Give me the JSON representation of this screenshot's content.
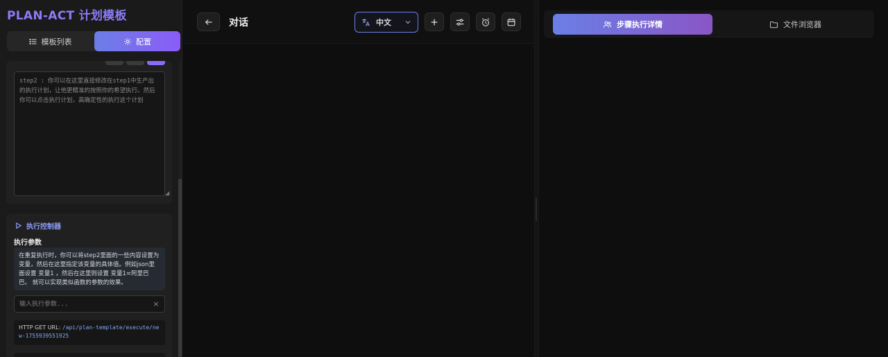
{
  "app": {
    "title": "PLAN-ACT 计划模板"
  },
  "sidebar": {
    "tabs": {
      "list_label": "模板列表",
      "config_label": "配置"
    },
    "plan_editor": {
      "value": "step2 : 你可以在这里直接修改在step1中生产出的执行计划，让他更精准的按照你的希望执行。然后你可以点击执行计划，高确定性的执行这个计划"
    },
    "exec": {
      "title": "执行控制器",
      "params_label": "执行参数",
      "info": "在重复执行时，你可以将step2里面的一些内容设置为变量，然后在这里指定该变量的具体值。例如json里面设置 变量1 ，然后在这里则设置 变量1=阿里巴巴。 就可以实现类似函数的参数的效果。",
      "input_placeholder": "输入执行参数...",
      "clear_symbol": "×",
      "url_label": "HTTP GET URL:",
      "url_value": "/api/plan-template/execute/new-1755939551925"
    }
  },
  "center": {
    "title": "对话",
    "language": {
      "selected": "中文"
    }
  },
  "right": {
    "tabs": {
      "steps_label": "步骤执行详情",
      "files_label": "文件浏览器"
    }
  },
  "colors": {
    "accent_start": "#6c7ee6",
    "accent_end": "#8b5cf6",
    "brand": "#8b7cf6",
    "link": "#7fa8f2"
  },
  "icons": [
    "list-icon",
    "gear-icon",
    "play-icon",
    "arrow-left-icon",
    "translate-icon",
    "chevron-down-icon",
    "plus-icon",
    "sliders-icon",
    "alarm-icon",
    "calendar-icon",
    "users-icon",
    "folder-icon"
  ]
}
